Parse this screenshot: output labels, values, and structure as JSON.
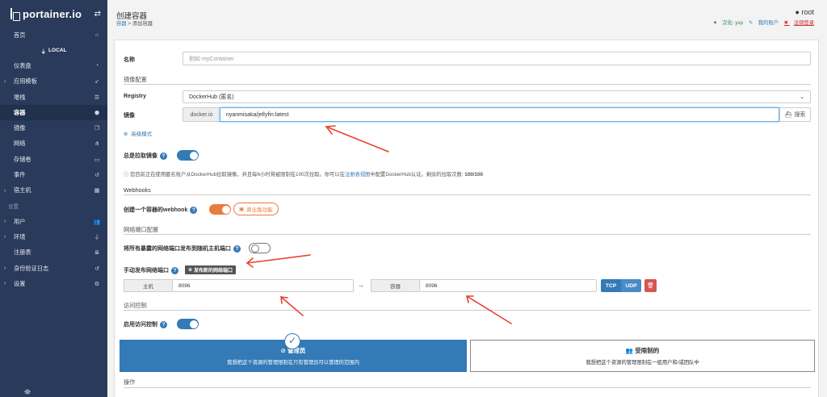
{
  "brand": {
    "name": "portainer.io",
    "toggle_icon": "swap-icon"
  },
  "sidebar": {
    "home": "首页",
    "endpoint": "LOCAL",
    "items": [
      {
        "label": "仪表盘",
        "icon": "tachometer-icon"
      },
      {
        "label": "应用模板",
        "icon": "rocket-icon",
        "caret": "›"
      },
      {
        "label": "堆栈",
        "icon": "th-list-icon"
      },
      {
        "label": "容器",
        "icon": "cubes-icon",
        "active": true
      },
      {
        "label": "镜像",
        "icon": "clone-icon"
      },
      {
        "label": "网络",
        "icon": "sitemap-icon"
      },
      {
        "label": "存储卷",
        "icon": "hdd-icon"
      },
      {
        "label": "事件",
        "icon": "history-icon"
      },
      {
        "label": "宿主机",
        "icon": "th-icon",
        "caret": "›"
      }
    ],
    "settings_heading": "设置",
    "settings_items": [
      {
        "label": "用户",
        "icon": "users-icon",
        "caret": "›"
      },
      {
        "label": "环境",
        "icon": "plug-icon",
        "caret": "›"
      },
      {
        "label": "注册表",
        "icon": "database-icon"
      },
      {
        "label": "身份验证日志",
        "icon": "history-icon",
        "caret": "›"
      },
      {
        "label": "设置",
        "icon": "cogs-icon",
        "caret": "›"
      }
    ]
  },
  "header": {
    "title": "创建容器",
    "breadcrumb_link": "容器",
    "breadcrumb_sep": " > ",
    "breadcrumb_current": "添加容器",
    "user": "root",
    "thanks": "汉化: ysp",
    "my_account": "我的账户",
    "logout": "注销登录"
  },
  "form": {
    "name_label": "名称",
    "name_placeholder": "例如 myContainer",
    "image_section": "镜像配置",
    "registry_label": "Registry",
    "registry_value": "DockerHub (匿名)",
    "image_label": "镜像",
    "image_prefix": "docker.io",
    "image_value": "nyanmisaka/jellyfin:latest",
    "search_button": "搜索",
    "advanced_mode": "高级模式",
    "always_pull_label": "总是拉取镜像",
    "always_pull": true,
    "rate_info_pre": "您目前正在使用匿名账户从DockerHub拉取镜像，并且每6小时将被限制在100次拉取。你可以在",
    "rate_info_link": "注册表视图",
    "rate_info_mid": "中配置DockerHub认证。剩余的拉取次数:",
    "rate_info_count": "100/100",
    "webhooks_section": "Webhooks",
    "webhook_label": "创建一个容器的webhook",
    "webhook_badge": "商业版功能",
    "ports_section": "网络端口配置",
    "publish_all_label": "将所有暴露的网络端口发布到随机主机端口",
    "publish_all": false,
    "manual_publish_label": "手动发布网络端口",
    "publish_new_button": "发布新的网络端口",
    "host_label": "主机",
    "host_port": "8096",
    "container_label": "容器",
    "container_port": "8096",
    "tcp": "TCP",
    "udp": "UDP",
    "access_section": "访问控制",
    "access_label": "启用访问控制",
    "access_enabled": true,
    "admin_title": "管理员",
    "admin_desc": "我想把这个资源的管理限制在只有管理员可以管理的范围内",
    "restricted_title": "受限制的",
    "restricted_desc": "我想把这个资源的管理限制在一组用户和/或团队中",
    "actions_section": "操作"
  },
  "colors": {
    "sidebar": "#293a5a",
    "primary": "#337ab7",
    "danger": "#d9534f",
    "annotation": "#e8432e",
    "webhook_toggle": "#e87b3e"
  }
}
